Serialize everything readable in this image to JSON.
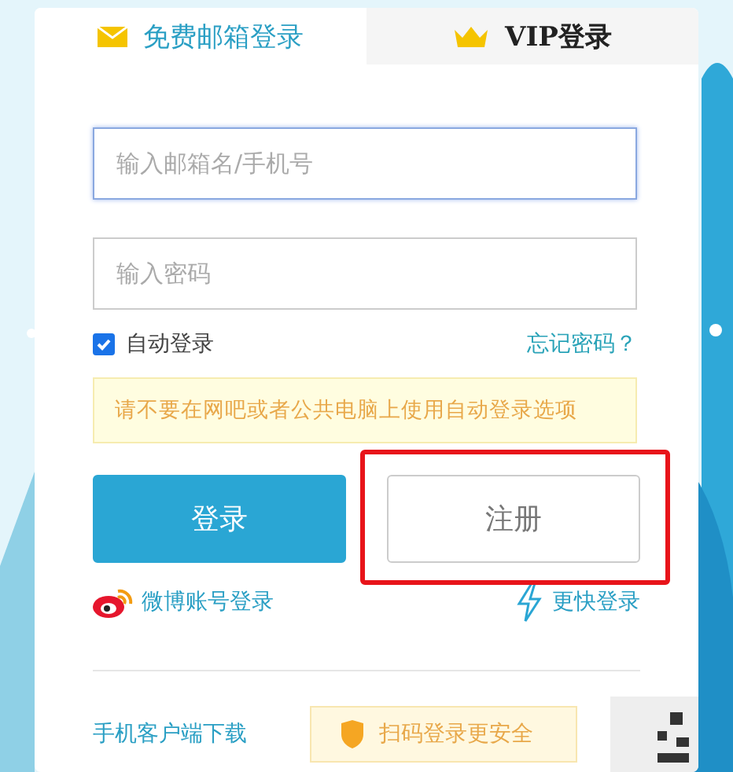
{
  "tabs": [
    {
      "label": "免费邮箱登录",
      "kind": "mail",
      "selected": true
    },
    {
      "label": "VIP登录",
      "kind": "crown",
      "selected": false
    }
  ],
  "fields": [
    {
      "placeholder": "输入邮箱名/手机号",
      "focused": true
    },
    {
      "placeholder": "输入密码",
      "focused": false
    }
  ],
  "auto_login": {
    "label": "自动登录",
    "checked": true
  },
  "forgot_link": "忘记密码？",
  "warning": "请不要在网吧或者公共电脑上使用自动登录选项",
  "buttons": [
    {
      "label": "登录",
      "kind": "primary"
    },
    {
      "label": "注册",
      "kind": "secondary",
      "highlighted": true
    }
  ],
  "alt_logins": [
    {
      "label": "微博账号登录",
      "kind": "weibo"
    },
    {
      "label": "更快登录",
      "kind": "bolt"
    }
  ],
  "footer": {
    "download_link": "手机客户端下载",
    "qr_tip": "扫码登录更安全"
  }
}
